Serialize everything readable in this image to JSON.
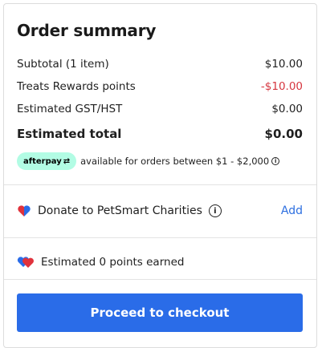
{
  "summary": {
    "title": "Order summary",
    "lines": [
      {
        "label": "Subtotal (1 item)",
        "value": "$10.00"
      },
      {
        "label": "Treats Rewards points",
        "value": "-$10.00"
      },
      {
        "label": "Estimated GST/HST",
        "value": "$0.00"
      }
    ],
    "total": {
      "label": "Estimated total",
      "value": "$0.00"
    },
    "negative_color": "#d6363f"
  },
  "afterpay": {
    "badge": "afterpay",
    "text": "available for orders between $1 - $2,000",
    "badge_color": "#b2fce4"
  },
  "donate": {
    "label": "Donate to PetSmart Charities",
    "add_label": "Add",
    "icon": "heart-icon"
  },
  "points": {
    "label": "Estimated 0 points earned",
    "icon": "hearts-icon"
  },
  "checkout": {
    "label": "Proceed to checkout",
    "color": "#2a6ce8"
  }
}
